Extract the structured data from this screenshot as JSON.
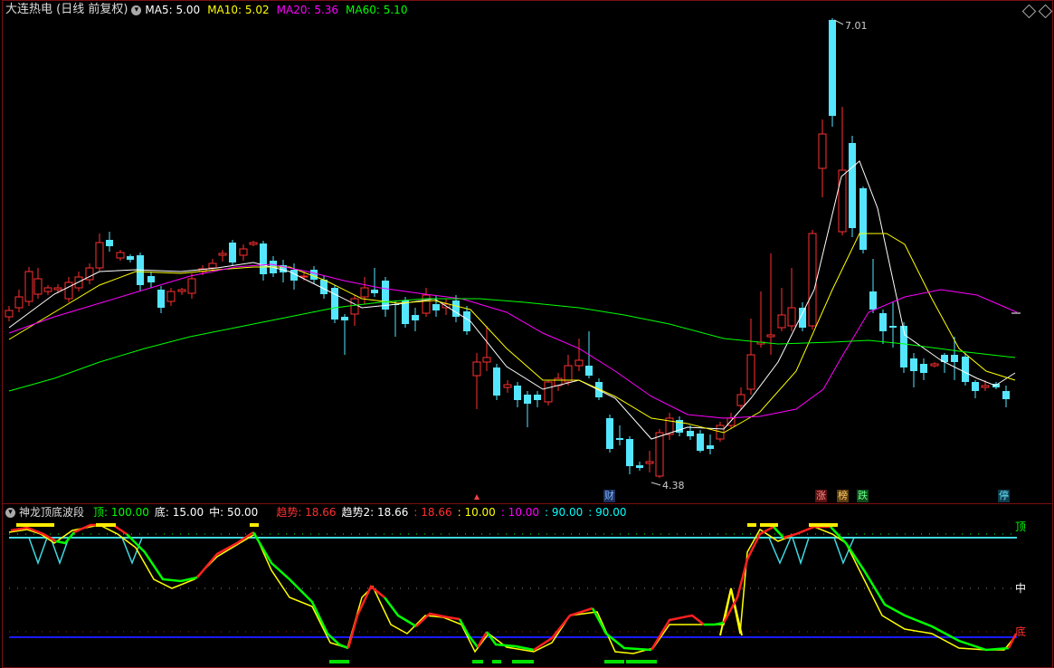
{
  "main_title": "大连热电 (日线 前复权)",
  "ma_legend": [
    {
      "label": "MA5: 5.00",
      "color": "#ffffff"
    },
    {
      "label": "MA10: 5.02",
      "color": "#ffff00"
    },
    {
      "label": "MA20: 5.36",
      "color": "#ff00ff"
    },
    {
      "label": "MA60: 5.10",
      "color": "#00ff00"
    }
  ],
  "high_label": "7.01",
  "low_label": "4.38",
  "event_tags": [
    {
      "text": "财",
      "bg": "#1c2e5a",
      "color": "#7fb6ff"
    },
    {
      "text": "涨",
      "bg": "#5a1010",
      "color": "#ff8a8a"
    },
    {
      "text": "榜",
      "bg": "#5a3a10",
      "color": "#ffcc66"
    },
    {
      "text": "跌",
      "bg": "#0e4a1a",
      "color": "#66ff88"
    },
    {
      "text": "停",
      "bg": "#0e3a4a",
      "color": "#66e6ff"
    }
  ],
  "indicator": {
    "name": "神龙顶底波段",
    "params": [
      {
        "text": "顶: 100.00",
        "color": "#00ff00"
      },
      {
        "text": "底: 15.00",
        "color": "#ffffff"
      },
      {
        "text": "中: 50.00",
        "color": "#ffffff"
      },
      {
        "text": "趋势: 18.66",
        "color": "#ff3030"
      },
      {
        "text": "趋势2: 18.66",
        "color": "#ffffff"
      },
      {
        "text": ": 18.66",
        "color": "#ff3030"
      },
      {
        "text": ": 10.00",
        "color": "#ffff00"
      },
      {
        "text": ": 10.00",
        "color": "#ff00ff"
      },
      {
        "text": ": 90.00",
        "color": "#00ffff"
      },
      {
        "text": ": 90.00",
        "color": "#00ffff"
      }
    ],
    "axis_labels": {
      "top": "顶",
      "mid": "中",
      "bottom": "底"
    }
  },
  "colors": {
    "up": "#ff3030",
    "down": "#55e6ff",
    "ma5": "#ffffff",
    "ma10": "#ffff00",
    "ma20": "#ff00ff",
    "ma60": "#00ff00",
    "frame": "#7a1010"
  }
}
